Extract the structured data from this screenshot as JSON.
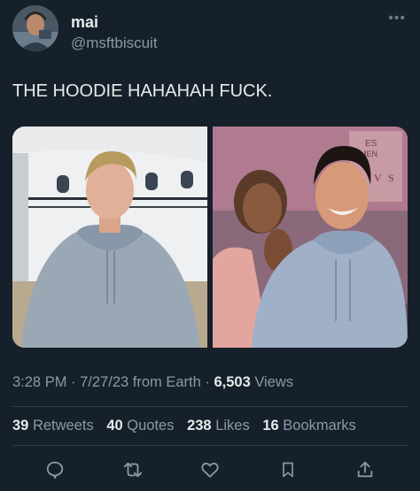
{
  "author": {
    "display_name": "mai",
    "handle": "@msftbiscuit"
  },
  "tweet": {
    "text": "THE HOODIE HAHAHAH FUCK."
  },
  "media": {
    "left_photo": "man-in-grey-hoodie-by-jet",
    "right_photo": "couple-selfie-grey-hoodie",
    "sign_text": [
      "ES",
      "MEN",
      "V",
      "S"
    ]
  },
  "meta": {
    "time": "3:28 PM",
    "sep1": " · ",
    "date": "7/27/23",
    "source": " from Earth",
    "sep2": " · ",
    "views_count": "6,503",
    "views_label": " Views"
  },
  "stats": {
    "retweets_count": "39",
    "retweets_label": "Retweets",
    "quotes_count": "40",
    "quotes_label": "Quotes",
    "likes_count": "238",
    "likes_label": "Likes",
    "bookmarks_count": "16",
    "bookmarks_label": "Bookmarks"
  },
  "actions": [
    "reply-icon",
    "retweet-icon",
    "like-icon",
    "bookmark-icon",
    "share-icon"
  ],
  "colors": {
    "background": "#16202b",
    "text_primary": "#e7e9ea",
    "text_secondary": "#8b98a5",
    "divider": "#2f3b47"
  }
}
